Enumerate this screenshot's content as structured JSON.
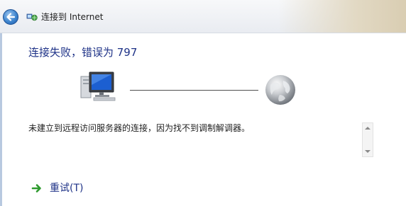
{
  "window": {
    "title": "连接到 Internet",
    "icon": "network-globe-icon",
    "back_icon": "back-arrow-icon"
  },
  "main": {
    "heading": "连接失败，错误为 797",
    "diagram": {
      "left_icon": "computer-icon",
      "right_icon": "globe-icon"
    },
    "message": "未建立到远程访问服务器的连接，因为找不到调制解调器。",
    "retry_label": "重试(T)",
    "retry_icon": "green-arrow-icon"
  },
  "colors": {
    "heading": "#1e3287",
    "link": "#1e3287",
    "back_button": "#3f86cf",
    "retry_arrow": "#2e9a2e"
  }
}
